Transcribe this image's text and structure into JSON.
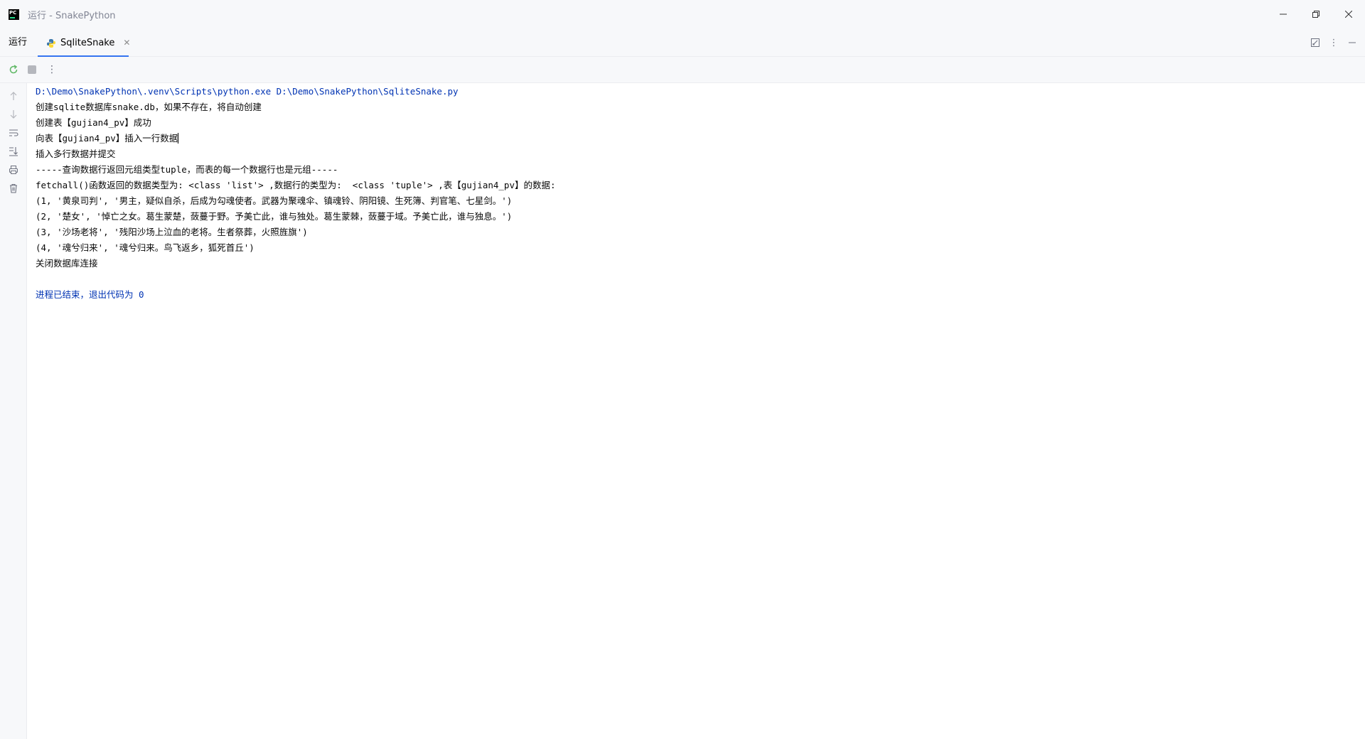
{
  "window": {
    "title": "运行 - SnakePython",
    "logo_text": "PC"
  },
  "tool_window": {
    "title": "运行",
    "tab_label": "SqliteSnake"
  },
  "console": {
    "lines": [
      "D:\\Demo\\SnakePython\\.venv\\Scripts\\python.exe D:\\Demo\\SnakePython\\SqliteSnake.py",
      "创建sqlite数据库snake.db，如果不存在，将自动创建",
      "创建表【gujian4_pv】成功",
      "向表【gujian4_pv】插入一行数据",
      "插入多行数据并提交",
      "-----查询数据行返回元组类型tuple，而表的每一个数据行也是元组-----",
      "fetchall()函数返回的数据类型为: <class 'list'> ,数据行的类型为:  <class 'tuple'> ,表【gujian4_pv】的数据:",
      "(1, '黄泉司判', '男主，疑似自杀，后成为勾魂使者。武器为聚魂伞、镇魂铃、阴阳镜、生死簿、判官笔、七星剑。')",
      "(2, '楚女', '悼亡之女。葛生蒙楚，蔹蔓于野。予美亡此，谁与独处。葛生蒙棘，蔹蔓于域。予美亡此，谁与独息。')",
      "(3, '沙场老将', '残阳沙场上泣血的老将。生者祭葬，火照旌旗')",
      "(4, '魂兮归来', '魂兮归来。鸟飞返乡，狐死首丘')",
      "关闭数据库连接",
      "",
      "进程已结束，退出代码为 0"
    ]
  }
}
